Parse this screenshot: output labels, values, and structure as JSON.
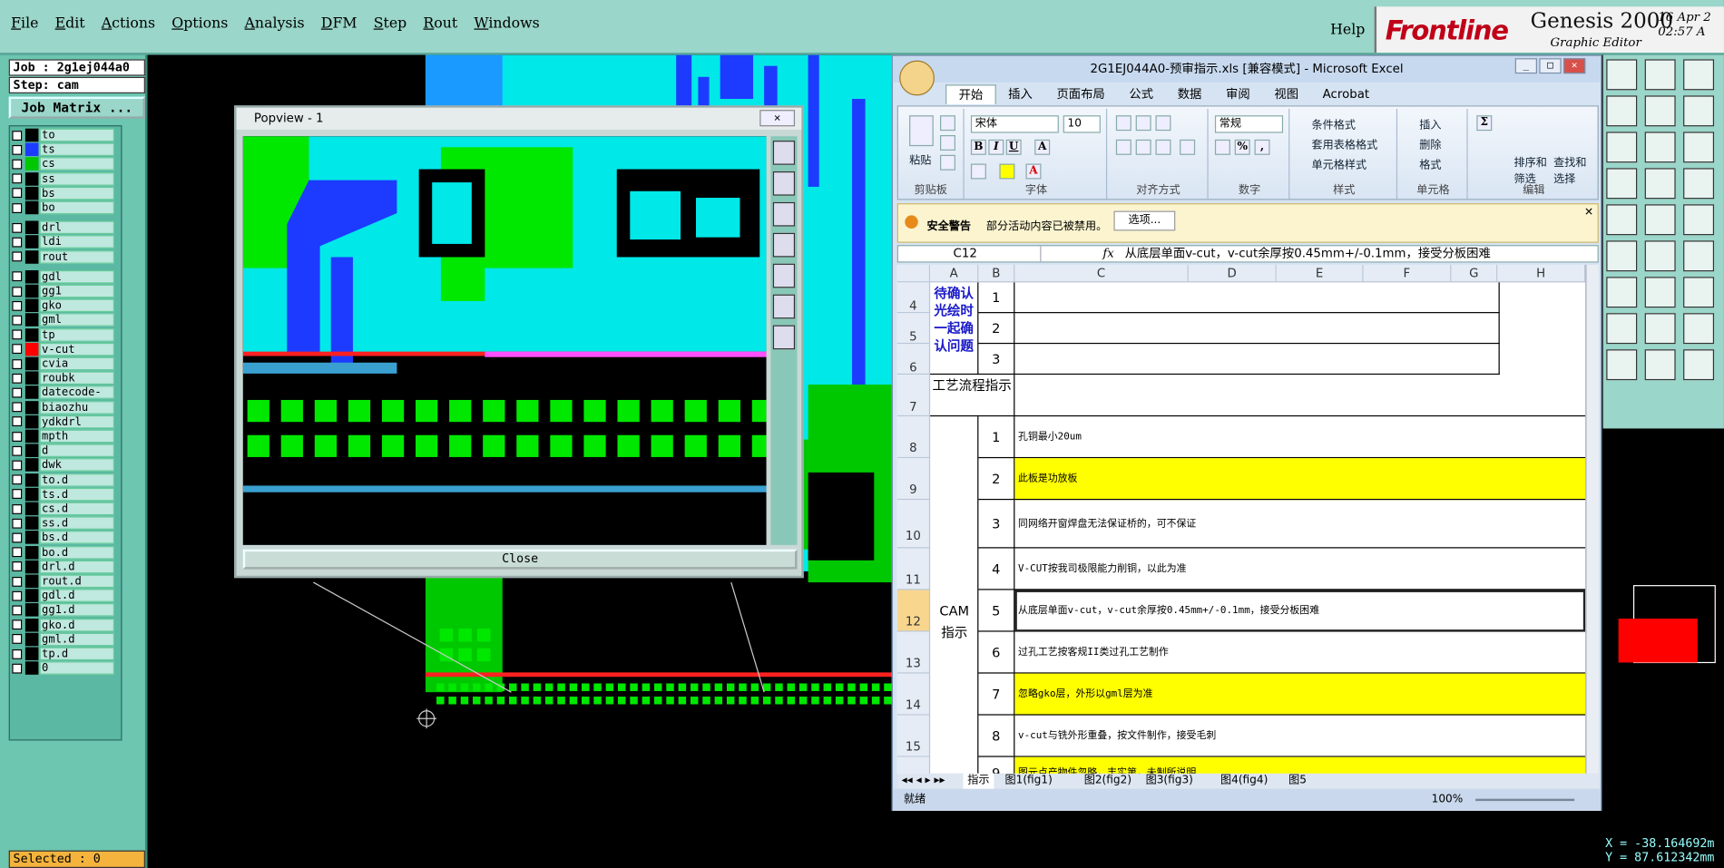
{
  "genesis": {
    "menu": [
      "File",
      "Edit",
      "Actions",
      "Options",
      "Analysis",
      "DFM",
      "Step",
      "Rout",
      "Windows"
    ],
    "help": "Help",
    "logo": "Frontline",
    "product": "Genesis 2000",
    "subtitle": "Graphic Editor",
    "date": "16 Apr 2",
    "time": "02:57 A",
    "job": "Job : 2g1ej044a0",
    "step": "Step: cam",
    "job_matrix": "Job Matrix ...",
    "selected": "Selected : 0",
    "coord_x": "X = -38.164692m",
    "coord_y": "Y = 87.612342mm"
  },
  "layers": [
    {
      "name": "to",
      "color": "#000000"
    },
    {
      "name": "ts",
      "color": "#1d3bff"
    },
    {
      "name": "cs",
      "color": "#00c800"
    },
    {
      "name": "ss",
      "color": "#000000"
    },
    {
      "name": "bs",
      "color": "#000000"
    },
    {
      "name": "bo",
      "color": "#000000"
    },
    {
      "name": "drl",
      "color": "#000000"
    },
    {
      "name": "ldi",
      "color": "#000000"
    },
    {
      "name": "rout",
      "color": "#000000"
    },
    {
      "name": "gdl",
      "color": "#000000"
    },
    {
      "name": "gg1",
      "color": "#000000"
    },
    {
      "name": "gko",
      "color": "#000000"
    },
    {
      "name": "gml",
      "color": "#000000"
    },
    {
      "name": "tp",
      "color": "#000000"
    },
    {
      "name": "v-cut",
      "color": "#ff0000"
    },
    {
      "name": "cvia",
      "color": "#000000"
    },
    {
      "name": "roubk",
      "color": "#000000"
    },
    {
      "name": "datecode-to",
      "color": "#000000"
    },
    {
      "name": "biaozhu",
      "color": "#000000"
    },
    {
      "name": "ydkdrl",
      "color": "#000000"
    },
    {
      "name": "mpth",
      "color": "#000000"
    },
    {
      "name": "d",
      "color": "#000000"
    },
    {
      "name": "dwk",
      "color": "#000000"
    },
    {
      "name": "to.d",
      "color": "#000000"
    },
    {
      "name": "ts.d",
      "color": "#000000"
    },
    {
      "name": "cs.d",
      "color": "#000000"
    },
    {
      "name": "ss.d",
      "color": "#000000"
    },
    {
      "name": "bs.d",
      "color": "#000000"
    },
    {
      "name": "bo.d",
      "color": "#000000"
    },
    {
      "name": "drl.d",
      "color": "#000000"
    },
    {
      "name": "rout.d",
      "color": "#000000"
    },
    {
      "name": "gdl.d",
      "color": "#000000"
    },
    {
      "name": "gg1.d",
      "color": "#000000"
    },
    {
      "name": "gko.d",
      "color": "#000000"
    },
    {
      "name": "gml.d",
      "color": "#000000"
    },
    {
      "name": "tp.d",
      "color": "#000000"
    },
    {
      "name": "0",
      "color": "#000000"
    }
  ],
  "popview": {
    "title": "Popview - 1",
    "close": "Close"
  },
  "excel": {
    "title": "2G1EJ044A0-预审指示.xls [兼容模式] - Microsoft Excel",
    "tabs": [
      "开始",
      "插入",
      "页面布局",
      "公式",
      "数据",
      "审阅",
      "视图",
      "Acrobat"
    ],
    "groups": [
      "剪贴板",
      "字体",
      "对齐方式",
      "数字",
      "样式",
      "单元格",
      "编辑"
    ],
    "paste": "粘贴",
    "font": "宋体",
    "size": "10",
    "number_format": "常规",
    "styles": [
      "条件格式",
      "套用表格格式",
      "单元格样式"
    ],
    "cells_ops": [
      "插入",
      "删除",
      "格式"
    ],
    "edit_ops": [
      "排序和筛选",
      "查找和选择"
    ],
    "security_title": "安全警告",
    "security_msg": "部分活动内容已被禁用。",
    "security_btn": "选项...",
    "namebox": "C12",
    "formula": "从底层单面v-cut，v-cut余厚按0.45mm+/-0.1mm，接受分板困难",
    "columns": [
      "A",
      "B",
      "C",
      "D",
      "E",
      "F",
      "G",
      "H"
    ],
    "left_label_top": "待确认光绘时一起确认问题",
    "row7": "工艺流程指示",
    "cam_label_1": "CAM",
    "cam_label_2": "指示",
    "confirm_rows": [
      {
        "row": "4",
        "num": "1"
      },
      {
        "row": "5",
        "num": "2"
      },
      {
        "row": "6",
        "num": "3"
      }
    ],
    "rows": [
      {
        "row": "8",
        "num": "1",
        "text": "孔铜最小20um"
      },
      {
        "row": "9",
        "num": "2",
        "text": "此板是功放板"
      },
      {
        "row": "10",
        "num": "3",
        "text": "同网络开窗焊盘无法保证桥的，可不保证"
      },
      {
        "row": "11",
        "num": "4",
        "text": "V-CUT按我司极限能力削铜，以此为准"
      },
      {
        "row": "12",
        "num": "5",
        "text": "从底层单面v-cut，v-cut余厚按0.45mm+/-0.1mm，接受分板困难"
      },
      {
        "row": "13",
        "num": "6",
        "text": "过孔工艺按客规II类过孔工艺制作"
      },
      {
        "row": "14",
        "num": "7",
        "text": "忽略gko层，外形以gml层为准"
      },
      {
        "row": "15",
        "num": "8",
        "text": "v-cut与铣外形重叠，按文件制作，接受毛刺"
      },
      {
        "row": "",
        "num": "9",
        "text": "图元点产物件忽略，丰实第，未制所说明"
      }
    ],
    "sheet_tabs": [
      "指示",
      "图1(fig1)",
      "图2(fig2)",
      "图3(fig3)",
      "图4(fig4)",
      "图5"
    ],
    "status": "就绪",
    "zoom": "100%"
  }
}
